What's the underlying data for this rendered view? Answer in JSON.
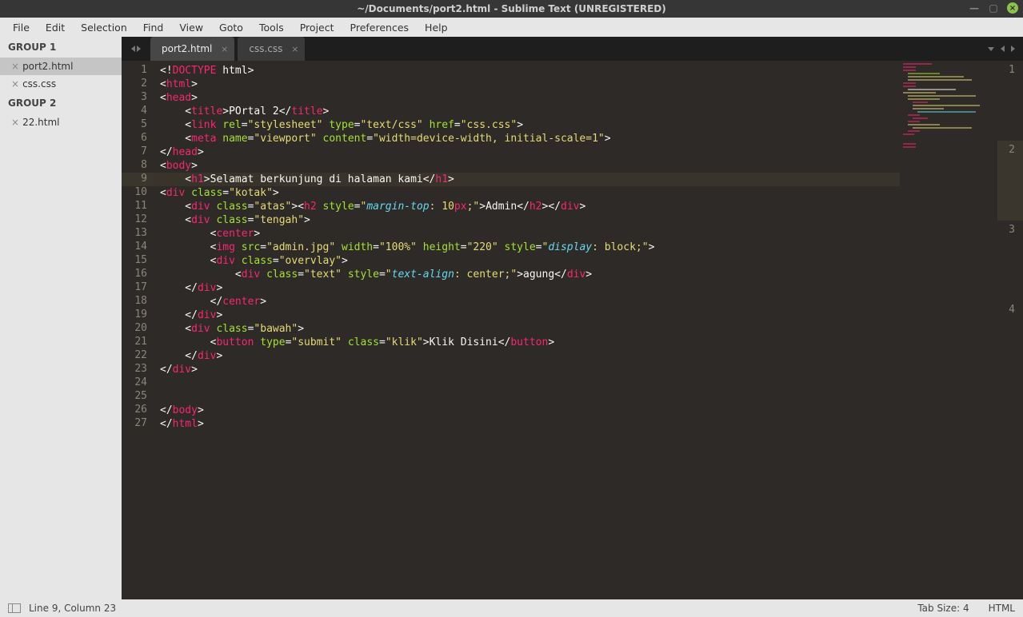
{
  "window": {
    "title": "~/Documents/port2.html - Sublime Text (UNREGISTERED)"
  },
  "menu": {
    "file": "File",
    "edit": "Edit",
    "selection": "Selection",
    "find": "Find",
    "view": "View",
    "goto": "Goto",
    "tools": "Tools",
    "project": "Project",
    "preferences": "Preferences",
    "help": "Help"
  },
  "sidebar": {
    "group1_label": "GROUP 1",
    "group1_items": [
      "port2.html",
      "css.css"
    ],
    "group2_label": "GROUP 2",
    "group2_items": [
      "22.html"
    ]
  },
  "tabs": {
    "tab1": "port2.html",
    "tab2": "css.css"
  },
  "right_gutter": {
    "r1": "1",
    "r2": "2",
    "r3": "3",
    "r4": "4"
  },
  "status": {
    "position": "Line 9, Column 23",
    "tabsize": "Tab Size: 4",
    "syntax": "HTML"
  },
  "code": {
    "line_count": 27,
    "highlight_line": 9,
    "tokens": [
      [
        [
          "<!",
          "p"
        ],
        [
          "DOCTYPE",
          "d"
        ],
        [
          " html",
          "p"
        ],
        [
          ">",
          "p"
        ]
      ],
      [
        [
          "<",
          "p"
        ],
        [
          "html",
          "t"
        ],
        [
          ">",
          "p"
        ]
      ],
      [
        [
          "<",
          "p"
        ],
        [
          "head",
          "t"
        ],
        [
          ">",
          "p"
        ]
      ],
      [
        [
          "    <",
          "p"
        ],
        [
          "title",
          "t"
        ],
        [
          ">",
          "p"
        ],
        [
          "POrtal 2",
          "x"
        ],
        [
          "</",
          "p"
        ],
        [
          "title",
          "t"
        ],
        [
          ">",
          "p"
        ]
      ],
      [
        [
          "    <",
          "p"
        ],
        [
          "link",
          "t"
        ],
        [
          " ",
          "p"
        ],
        [
          "rel",
          "a"
        ],
        [
          "=",
          "p"
        ],
        [
          "\"stylesheet\"",
          "s"
        ],
        [
          " ",
          "p"
        ],
        [
          "type",
          "a"
        ],
        [
          "=",
          "p"
        ],
        [
          "\"text/css\"",
          "s"
        ],
        [
          " ",
          "p"
        ],
        [
          "href",
          "a"
        ],
        [
          "=",
          "p"
        ],
        [
          "\"css.css\"",
          "s"
        ],
        [
          ">",
          "p"
        ]
      ],
      [
        [
          "    <",
          "p"
        ],
        [
          "meta",
          "t"
        ],
        [
          " ",
          "p"
        ],
        [
          "name",
          "a"
        ],
        [
          "=",
          "p"
        ],
        [
          "\"viewport\"",
          "s"
        ],
        [
          " ",
          "p"
        ],
        [
          "content",
          "a"
        ],
        [
          "=",
          "p"
        ],
        [
          "\"width=device-width, initial-scale=1\"",
          "s"
        ],
        [
          ">",
          "p"
        ]
      ],
      [
        [
          "</",
          "p"
        ],
        [
          "head",
          "t"
        ],
        [
          ">",
          "p"
        ]
      ],
      [
        [
          "<",
          "p"
        ],
        [
          "body",
          "t"
        ],
        [
          ">",
          "p"
        ]
      ],
      [
        [
          "    <",
          "p"
        ],
        [
          "h1",
          "t"
        ],
        [
          ">",
          "p"
        ],
        [
          "Selamat berkunjung di halaman kami",
          "x"
        ],
        [
          "</",
          "p"
        ],
        [
          "h1",
          "t"
        ],
        [
          ">",
          "p"
        ]
      ],
      [
        [
          "<",
          "p"
        ],
        [
          "div",
          "t"
        ],
        [
          " ",
          "p"
        ],
        [
          "class",
          "a"
        ],
        [
          "=",
          "p"
        ],
        [
          "\"kotak\"",
          "s"
        ],
        [
          ">",
          "p"
        ]
      ],
      [
        [
          "    <",
          "p"
        ],
        [
          "div",
          "t"
        ],
        [
          " ",
          "p"
        ],
        [
          "class",
          "a"
        ],
        [
          "=",
          "p"
        ],
        [
          "\"atas\"",
          "s"
        ],
        [
          "><",
          "p"
        ],
        [
          "h2",
          "t"
        ],
        [
          " ",
          "p"
        ],
        [
          "style",
          "a"
        ],
        [
          "=",
          "p"
        ],
        [
          "\"",
          "s"
        ],
        [
          "margin-top",
          "k"
        ],
        [
          ": 10",
          "s"
        ],
        [
          "px",
          "t"
        ],
        [
          ";",
          "s"
        ],
        [
          "\"",
          "s"
        ],
        [
          ">",
          "p"
        ],
        [
          "Admin",
          "x"
        ],
        [
          "</",
          "p"
        ],
        [
          "h2",
          "t"
        ],
        [
          "></",
          "p"
        ],
        [
          "div",
          "t"
        ],
        [
          ">",
          "p"
        ]
      ],
      [
        [
          "    <",
          "p"
        ],
        [
          "div",
          "t"
        ],
        [
          " ",
          "p"
        ],
        [
          "class",
          "a"
        ],
        [
          "=",
          "p"
        ],
        [
          "\"tengah\"",
          "s"
        ],
        [
          ">",
          "p"
        ]
      ],
      [
        [
          "        <",
          "p"
        ],
        [
          "center",
          "t"
        ],
        [
          ">",
          "p"
        ]
      ],
      [
        [
          "        <",
          "p"
        ],
        [
          "img",
          "t"
        ],
        [
          " ",
          "p"
        ],
        [
          "src",
          "a"
        ],
        [
          "=",
          "p"
        ],
        [
          "\"admin.jpg\"",
          "s"
        ],
        [
          " ",
          "p"
        ],
        [
          "width",
          "a"
        ],
        [
          "=",
          "p"
        ],
        [
          "\"100%\"",
          "s"
        ],
        [
          " ",
          "p"
        ],
        [
          "height",
          "a"
        ],
        [
          "=",
          "p"
        ],
        [
          "\"220\"",
          "s"
        ],
        [
          " ",
          "p"
        ],
        [
          "style",
          "a"
        ],
        [
          "=",
          "p"
        ],
        [
          "\"",
          "s"
        ],
        [
          "display",
          "k"
        ],
        [
          ": block;",
          "s"
        ],
        [
          "\"",
          "s"
        ],
        [
          ">",
          "p"
        ]
      ],
      [
        [
          "        <",
          "p"
        ],
        [
          "div",
          "t"
        ],
        [
          " ",
          "p"
        ],
        [
          "class",
          "a"
        ],
        [
          "=",
          "p"
        ],
        [
          "\"overvlay\"",
          "s"
        ],
        [
          ">",
          "p"
        ]
      ],
      [
        [
          "            <",
          "p"
        ],
        [
          "div",
          "t"
        ],
        [
          " ",
          "p"
        ],
        [
          "class",
          "a"
        ],
        [
          "=",
          "p"
        ],
        [
          "\"text\"",
          "s"
        ],
        [
          " ",
          "p"
        ],
        [
          "style",
          "a"
        ],
        [
          "=",
          "p"
        ],
        [
          "\"",
          "s"
        ],
        [
          "text-align",
          "k"
        ],
        [
          ": center;",
          "s"
        ],
        [
          "\"",
          "s"
        ],
        [
          ">",
          "p"
        ],
        [
          "agung",
          "x"
        ],
        [
          "</",
          "p"
        ],
        [
          "div",
          "t"
        ],
        [
          ">",
          "p"
        ]
      ],
      [
        [
          "    </",
          "p"
        ],
        [
          "div",
          "t"
        ],
        [
          ">",
          "p"
        ]
      ],
      [
        [
          "        </",
          "p"
        ],
        [
          "center",
          "t"
        ],
        [
          ">",
          "p"
        ]
      ],
      [
        [
          "    </",
          "p"
        ],
        [
          "div",
          "t"
        ],
        [
          ">",
          "p"
        ]
      ],
      [
        [
          "    <",
          "p"
        ],
        [
          "div",
          "t"
        ],
        [
          " ",
          "p"
        ],
        [
          "class",
          "a"
        ],
        [
          "=",
          "p"
        ],
        [
          "\"bawah\"",
          "s"
        ],
        [
          ">",
          "p"
        ]
      ],
      [
        [
          "        <",
          "p"
        ],
        [
          "button",
          "t"
        ],
        [
          " ",
          "p"
        ],
        [
          "type",
          "a"
        ],
        [
          "=",
          "p"
        ],
        [
          "\"submit\"",
          "s"
        ],
        [
          " ",
          "p"
        ],
        [
          "class",
          "a"
        ],
        [
          "=",
          "p"
        ],
        [
          "\"klik\"",
          "s"
        ],
        [
          ">",
          "p"
        ],
        [
          "Klik Disini",
          "x"
        ],
        [
          "</",
          "p"
        ],
        [
          "button",
          "t"
        ],
        [
          ">",
          "p"
        ]
      ],
      [
        [
          "    </",
          "p"
        ],
        [
          "div",
          "t"
        ],
        [
          ">",
          "p"
        ]
      ],
      [
        [
          "</",
          "p"
        ],
        [
          "div",
          "t"
        ],
        [
          ">",
          "p"
        ]
      ],
      [],
      [],
      [
        [
          "</",
          "p"
        ],
        [
          "body",
          "t"
        ],
        [
          ">",
          "p"
        ]
      ],
      [
        [
          "</",
          "p"
        ],
        [
          "html",
          "t"
        ],
        [
          ">",
          "p"
        ]
      ]
    ]
  }
}
